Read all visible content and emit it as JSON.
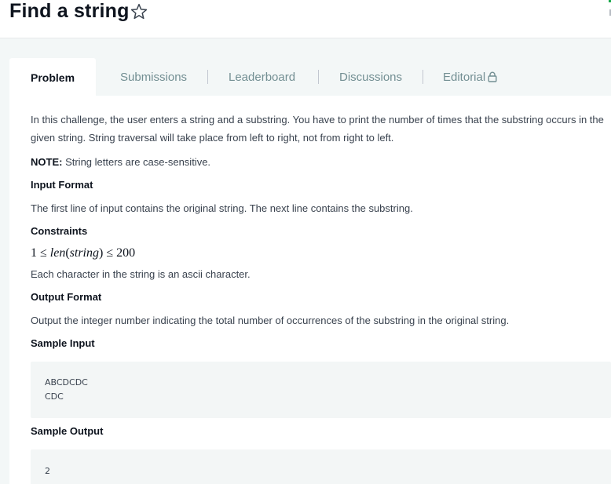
{
  "header": {
    "title": "Find a string"
  },
  "tabs": [
    {
      "label": "Problem"
    },
    {
      "label": "Submissions"
    },
    {
      "label": "Leaderboard"
    },
    {
      "label": "Discussions"
    },
    {
      "label": "Editorial"
    }
  ],
  "problem": {
    "intro": "In this challenge, the user enters a string and a substring. You have to print the number of times that the substring occurs in the given string. String traversal will take place from left to right, not from right to left.",
    "note_label": "NOTE:",
    "note_text": " String letters are case-sensitive.",
    "input_format_heading": "Input Format",
    "input_format_text": "The first line of input contains the original string. The next line contains the substring.",
    "constraints_heading": "Constraints",
    "constraint_math": {
      "lower": "1",
      "op1": "≤",
      "func": "len",
      "arg": "string",
      "op2": "≤",
      "upper": "200"
    },
    "constraint_text": "Each character in the string is an ascii character.",
    "output_format_heading": "Output Format",
    "output_format_text": "Output the integer number indicating the total number of occurrences of the substring in the original string.",
    "sample_input_heading": "Sample Input",
    "sample_input_lines": [
      "ABCDCDC",
      "CDC"
    ],
    "sample_output_heading": "Sample Output",
    "sample_output_lines": [
      "2"
    ]
  },
  "icons": {
    "star": "star-outline-icon",
    "lock": "lock-icon"
  },
  "colors": {
    "title": "#0e141e",
    "tab_inactive": "#738f93",
    "page_bg": "#f3f7f7",
    "code_bg": "#f3f6f6"
  }
}
